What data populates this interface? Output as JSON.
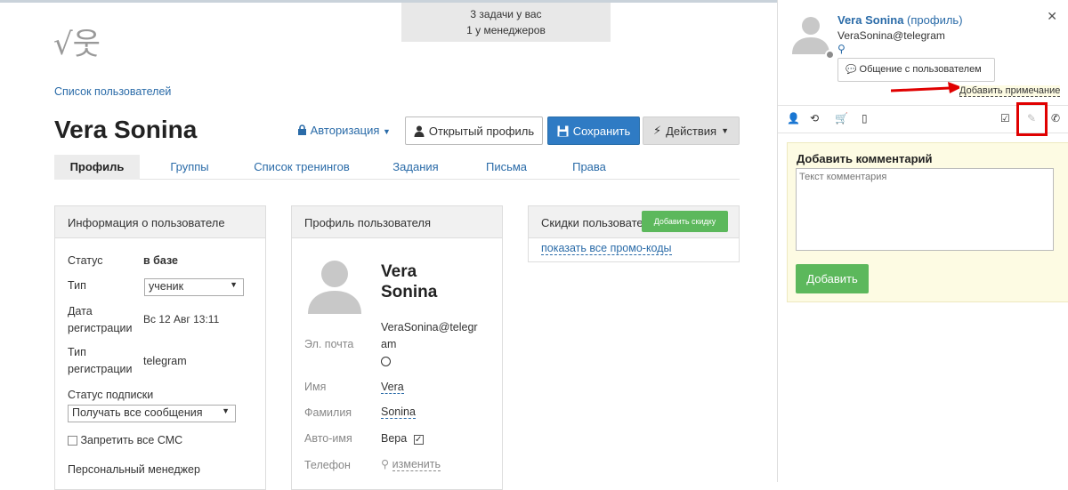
{
  "tasks": {
    "line1": "3 задачи у вас",
    "line2": "1 у менеджеров"
  },
  "logo": {
    "text": "√웃"
  },
  "breadcrumb": "Список пользователей",
  "user": {
    "name": "Vera Sonina"
  },
  "header": {
    "auth_label": "Авторизация",
    "open_profile": "Открытый профиль",
    "save": "Сохранить",
    "actions": "Действия"
  },
  "tabs": [
    "Профиль",
    "Группы",
    "Список тренингов",
    "Задания",
    "Письма",
    "Права"
  ],
  "info_panel": {
    "title": "Информация о пользователе",
    "status_label": "Статус",
    "status_value": "в базе",
    "type_label": "Тип",
    "type_value": "ученик",
    "regdate_label1": "Дата",
    "regdate_label2": "регистрации",
    "regdate_value": "Вс 12 Авг 13:11",
    "regtype_label1": "Тип",
    "regtype_label2": "регистрации",
    "regtype_value": "telegram",
    "sub_label": "Статус подписки",
    "sub_value": "Получать все сообщения",
    "no_sms": "Запретить все СМС",
    "manager_label": "Персональный менеджер"
  },
  "profile_panel": {
    "title": "Профиль пользователя",
    "first": "Vera",
    "last": "Sonina",
    "email_label": "Эл. почта",
    "email_value1": "VeraSonina@telegr",
    "email_value2": "am",
    "name_label": "Имя",
    "name_value": "Vera",
    "surname_label": "Фамилия",
    "surname_value": "Sonina",
    "autoname_label": "Авто-имя",
    "autoname_value": "Вера",
    "phone_label": "Телефон",
    "phone_action": "изменить"
  },
  "discount_panel": {
    "title": "Скидки пользовате",
    "add_button": "Добавить скидку",
    "show_promo": "показать все промо-коды"
  },
  "sidebar": {
    "name": "Vera Sonina",
    "profile_link": "(профиль)",
    "email": "VeraSonina@telegram",
    "chat_button": "Общение с пользователем",
    "add_note_tooltip": "Добавить примечание",
    "comment_title": "Добавить комментарий",
    "comment_placeholder": "Текст комментария",
    "add_button": "Добавить"
  },
  "colors": {
    "accent": "#2f7bc4",
    "link": "#2a6ba8",
    "green": "#5cb85c",
    "red": "#e00000"
  }
}
